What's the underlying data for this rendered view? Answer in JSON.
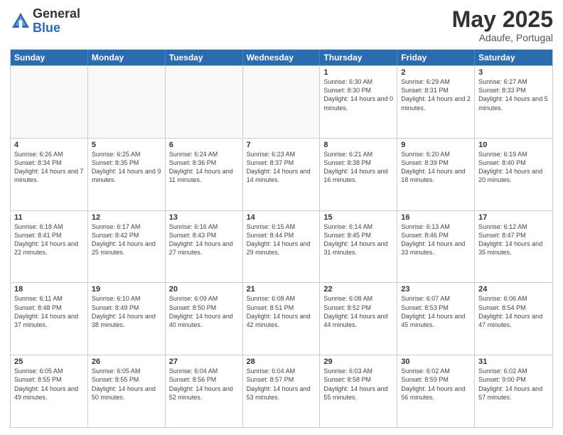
{
  "logo": {
    "general": "General",
    "blue": "Blue"
  },
  "title": "May 2025",
  "subtitle": "Adaufe, Portugal",
  "header_days": [
    "Sunday",
    "Monday",
    "Tuesday",
    "Wednesday",
    "Thursday",
    "Friday",
    "Saturday"
  ],
  "rows": [
    [
      {
        "day": "",
        "text": ""
      },
      {
        "day": "",
        "text": ""
      },
      {
        "day": "",
        "text": ""
      },
      {
        "day": "",
        "text": ""
      },
      {
        "day": "1",
        "text": "Sunrise: 6:30 AM\nSunset: 8:30 PM\nDaylight: 14 hours\nand 0 minutes."
      },
      {
        "day": "2",
        "text": "Sunrise: 6:29 AM\nSunset: 8:31 PM\nDaylight: 14 hours\nand 2 minutes."
      },
      {
        "day": "3",
        "text": "Sunrise: 6:27 AM\nSunset: 8:33 PM\nDaylight: 14 hours\nand 5 minutes."
      }
    ],
    [
      {
        "day": "4",
        "text": "Sunrise: 6:26 AM\nSunset: 8:34 PM\nDaylight: 14 hours\nand 7 minutes."
      },
      {
        "day": "5",
        "text": "Sunrise: 6:25 AM\nSunset: 8:35 PM\nDaylight: 14 hours\nand 9 minutes."
      },
      {
        "day": "6",
        "text": "Sunrise: 6:24 AM\nSunset: 8:36 PM\nDaylight: 14 hours\nand 11 minutes."
      },
      {
        "day": "7",
        "text": "Sunrise: 6:23 AM\nSunset: 8:37 PM\nDaylight: 14 hours\nand 14 minutes."
      },
      {
        "day": "8",
        "text": "Sunrise: 6:21 AM\nSunset: 8:38 PM\nDaylight: 14 hours\nand 16 minutes."
      },
      {
        "day": "9",
        "text": "Sunrise: 6:20 AM\nSunset: 8:39 PM\nDaylight: 14 hours\nand 18 minutes."
      },
      {
        "day": "10",
        "text": "Sunrise: 6:19 AM\nSunset: 8:40 PM\nDaylight: 14 hours\nand 20 minutes."
      }
    ],
    [
      {
        "day": "11",
        "text": "Sunrise: 6:18 AM\nSunset: 8:41 PM\nDaylight: 14 hours\nand 22 minutes."
      },
      {
        "day": "12",
        "text": "Sunrise: 6:17 AM\nSunset: 8:42 PM\nDaylight: 14 hours\nand 25 minutes."
      },
      {
        "day": "13",
        "text": "Sunrise: 6:16 AM\nSunset: 8:43 PM\nDaylight: 14 hours\nand 27 minutes."
      },
      {
        "day": "14",
        "text": "Sunrise: 6:15 AM\nSunset: 8:44 PM\nDaylight: 14 hours\nand 29 minutes."
      },
      {
        "day": "15",
        "text": "Sunrise: 6:14 AM\nSunset: 8:45 PM\nDaylight: 14 hours\nand 31 minutes."
      },
      {
        "day": "16",
        "text": "Sunrise: 6:13 AM\nSunset: 8:46 PM\nDaylight: 14 hours\nand 33 minutes."
      },
      {
        "day": "17",
        "text": "Sunrise: 6:12 AM\nSunset: 8:47 PM\nDaylight: 14 hours\nand 35 minutes."
      }
    ],
    [
      {
        "day": "18",
        "text": "Sunrise: 6:11 AM\nSunset: 8:48 PM\nDaylight: 14 hours\nand 37 minutes."
      },
      {
        "day": "19",
        "text": "Sunrise: 6:10 AM\nSunset: 8:49 PM\nDaylight: 14 hours\nand 38 minutes."
      },
      {
        "day": "20",
        "text": "Sunrise: 6:09 AM\nSunset: 8:50 PM\nDaylight: 14 hours\nand 40 minutes."
      },
      {
        "day": "21",
        "text": "Sunrise: 6:08 AM\nSunset: 8:51 PM\nDaylight: 14 hours\nand 42 minutes."
      },
      {
        "day": "22",
        "text": "Sunrise: 6:08 AM\nSunset: 8:52 PM\nDaylight: 14 hours\nand 44 minutes."
      },
      {
        "day": "23",
        "text": "Sunrise: 6:07 AM\nSunset: 8:53 PM\nDaylight: 14 hours\nand 45 minutes."
      },
      {
        "day": "24",
        "text": "Sunrise: 6:06 AM\nSunset: 8:54 PM\nDaylight: 14 hours\nand 47 minutes."
      }
    ],
    [
      {
        "day": "25",
        "text": "Sunrise: 6:05 AM\nSunset: 8:55 PM\nDaylight: 14 hours\nand 49 minutes."
      },
      {
        "day": "26",
        "text": "Sunrise: 6:05 AM\nSunset: 8:55 PM\nDaylight: 14 hours\nand 50 minutes."
      },
      {
        "day": "27",
        "text": "Sunrise: 6:04 AM\nSunset: 8:56 PM\nDaylight: 14 hours\nand 52 minutes."
      },
      {
        "day": "28",
        "text": "Sunrise: 6:04 AM\nSunset: 8:57 PM\nDaylight: 14 hours\nand 53 minutes."
      },
      {
        "day": "29",
        "text": "Sunrise: 6:03 AM\nSunset: 8:58 PM\nDaylight: 14 hours\nand 55 minutes."
      },
      {
        "day": "30",
        "text": "Sunrise: 6:02 AM\nSunset: 8:59 PM\nDaylight: 14 hours\nand 56 minutes."
      },
      {
        "day": "31",
        "text": "Sunrise: 6:02 AM\nSunset: 9:00 PM\nDaylight: 14 hours\nand 57 minutes."
      }
    ]
  ]
}
